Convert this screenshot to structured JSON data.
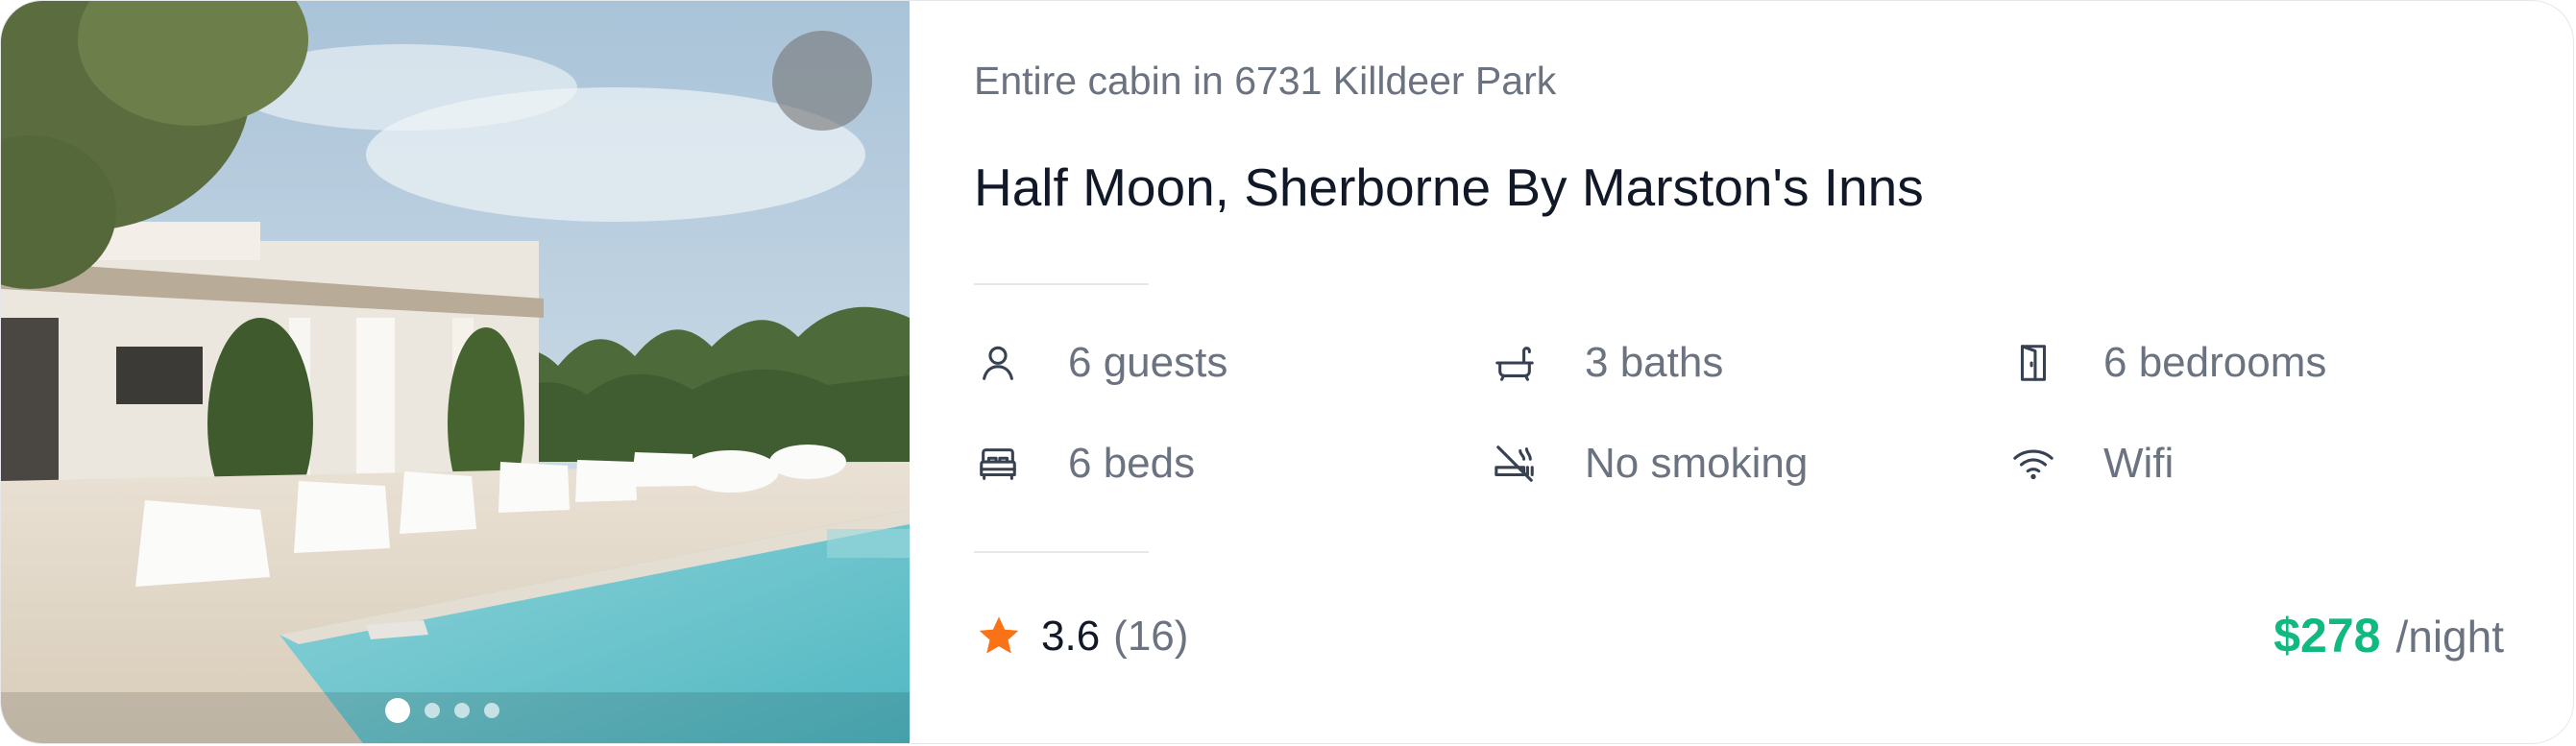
{
  "listing": {
    "subtitle": "Entire cabin in 6731 Killdeer Park",
    "title": "Half Moon, Sherborne By Marston's Inns",
    "amenities": [
      {
        "icon": "user-icon",
        "label": "6 guests"
      },
      {
        "icon": "bath-icon",
        "label": "3 baths"
      },
      {
        "icon": "door-icon",
        "label": "6 bedrooms"
      },
      {
        "icon": "bed-icon",
        "label": "6 beds"
      },
      {
        "icon": "no-smoking-icon",
        "label": "No smoking"
      },
      {
        "icon": "wifi-icon",
        "label": "Wifi"
      }
    ],
    "rating": {
      "score": "3.6",
      "count": "(16)",
      "icon": "star-icon"
    },
    "price": {
      "amount": "$278",
      "unit": "/night"
    }
  },
  "gallery": {
    "slides": 4,
    "active_index": 0
  },
  "colors": {
    "accent": "#10b981",
    "star": "#f97316",
    "title": "#111827",
    "muted": "#6b7280",
    "favorite_bg": "#7a7a7a"
  }
}
